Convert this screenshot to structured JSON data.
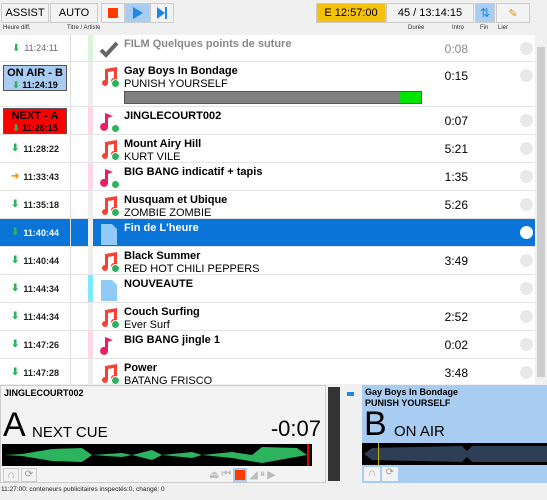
{
  "toolbar": {
    "assist": "ASSIST",
    "auto": "AUTO",
    "stop": "stop",
    "play": "play",
    "next": "next",
    "end_time": "E  12:57:00",
    "count_time": "45 / 13:14:15"
  },
  "colors": {
    "accent": "#0a74d9",
    "end_badge": "#f4c20d",
    "next_badge": "#ff0000",
    "onair_badge": "#a9cdf2",
    "waveform_a": "#2db35d"
  },
  "columns": {
    "time": "Heure diff.",
    "title": "Titre / Artiste",
    "duration": "Durée",
    "intro": "Intro",
    "fin": "Fin",
    "lier": "Lier"
  },
  "rows": [
    {
      "time": "11:24:11",
      "title": "FILM Quelques points de suture",
      "artist": "",
      "duration": "0:08",
      "icon": "check-icon",
      "stripe": "#d8f5d8",
      "played": true
    },
    {
      "time": "11:24:19",
      "badge": "ON AIR - B",
      "title": "Gay Boys In Bondage",
      "artist": "PUNISH YOURSELF",
      "duration": "0:15",
      "icon": "music-icon",
      "stripe": "#eee",
      "progress": 0.93
    },
    {
      "time": "11:28:15",
      "badge": "NEXT - A",
      "title": "JINGLECOURT002",
      "artist": "",
      "duration": "0:07",
      "icon": "jingle-icon",
      "stripe": "#ffd6e8"
    },
    {
      "time": "11:28:22",
      "title": "Mount Airy Hill",
      "artist": "KURT VILE",
      "duration": "5:21",
      "icon": "music-icon",
      "stripe": "#eee"
    },
    {
      "time": "11:33:43",
      "title": "BIG BANG indicatif + tapis",
      "artist": "",
      "duration": "1:35",
      "icon": "jingle-icon",
      "stripe": "#ffd6e8",
      "arrow": "orange"
    },
    {
      "time": "11:35:18",
      "title": "Nusquam et Ubique",
      "artist": "ZOMBIE ZOMBIE",
      "duration": "5:26",
      "icon": "music-icon",
      "stripe": "#eee"
    },
    {
      "time": "11:40:44",
      "title": "Fin de L'heure",
      "artist": "",
      "duration": "",
      "icon": "document-icon",
      "stripe": "#eee",
      "selected": true
    },
    {
      "time": "11:40:44",
      "title": "Black Summer",
      "artist": "RED HOT CHILI PEPPERS",
      "duration": "3:49",
      "icon": "music-icon",
      "stripe": "#eee"
    },
    {
      "time": "11:44:34",
      "title": "NOUVEAUTE",
      "artist": "",
      "duration": "",
      "icon": "document-icon",
      "stripe": "#7ee8ff"
    },
    {
      "time": "11:44:34",
      "title": "Couch Surfing",
      "artist": "Ever Surf",
      "duration": "2:52",
      "icon": "music-icon",
      "stripe": "#eee"
    },
    {
      "time": "11:47:26",
      "title": "BIG BANG jingle 1",
      "artist": "",
      "duration": "0:02",
      "icon": "jingle-icon",
      "stripe": "#ffd6e8"
    },
    {
      "time": "11:47:28",
      "title": "Power",
      "artist": "BATANG FRISCO",
      "duration": "3:48",
      "icon": "music-icon",
      "stripe": "#eee"
    }
  ],
  "deck_a": {
    "title": "JINGLECOURT002",
    "letter": "A",
    "state": "NEXT CUE",
    "remaining": "-0:07"
  },
  "deck_b": {
    "title": "Gay Boys In Bondage",
    "artist": "PUNISH YOURSELF",
    "letter": "B",
    "state": "ON AIR"
  },
  "status": "11:27:00: conteneurs publicitaires inspectés:0, changé: 0"
}
